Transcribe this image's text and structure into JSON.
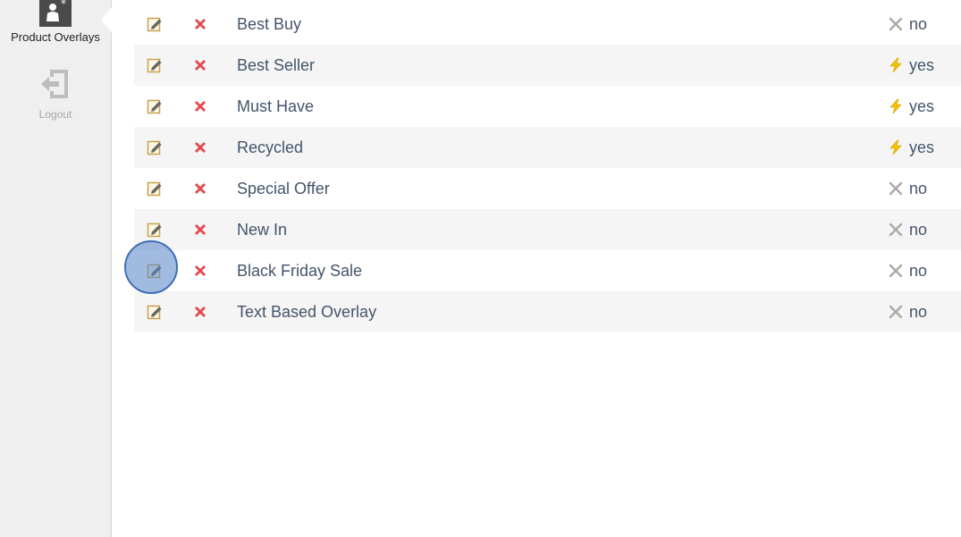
{
  "sidebar": {
    "items": [
      {
        "label": "Product Overlays",
        "icon": "product-overlays-icon",
        "active": true
      },
      {
        "label": "Logout",
        "icon": "logout-icon",
        "active": false
      }
    ]
  },
  "overlays": [
    {
      "name": "Best Buy",
      "status": "no",
      "status_icon": "cross-icon"
    },
    {
      "name": "Best Seller",
      "status": "yes",
      "status_icon": "lightning-icon"
    },
    {
      "name": "Must Have",
      "status": "yes",
      "status_icon": "lightning-icon"
    },
    {
      "name": "Recycled",
      "status": "yes",
      "status_icon": "lightning-icon"
    },
    {
      "name": "Special Offer",
      "status": "no",
      "status_icon": "cross-icon"
    },
    {
      "name": "New In",
      "status": "no",
      "status_icon": "cross-icon"
    },
    {
      "name": "Black Friday Sale",
      "status": "no",
      "status_icon": "cross-icon"
    },
    {
      "name": "Text Based Overlay",
      "status": "no",
      "status_icon": "cross-icon"
    }
  ],
  "colors": {
    "delete": "#e5484d",
    "lightning": "#f2c200",
    "cross_status": "#a9a9a9",
    "edit_icon": "#c8a24a",
    "text": "#44546a",
    "row_alt": "#f5f5f5",
    "click_marker": "#5483c7"
  }
}
